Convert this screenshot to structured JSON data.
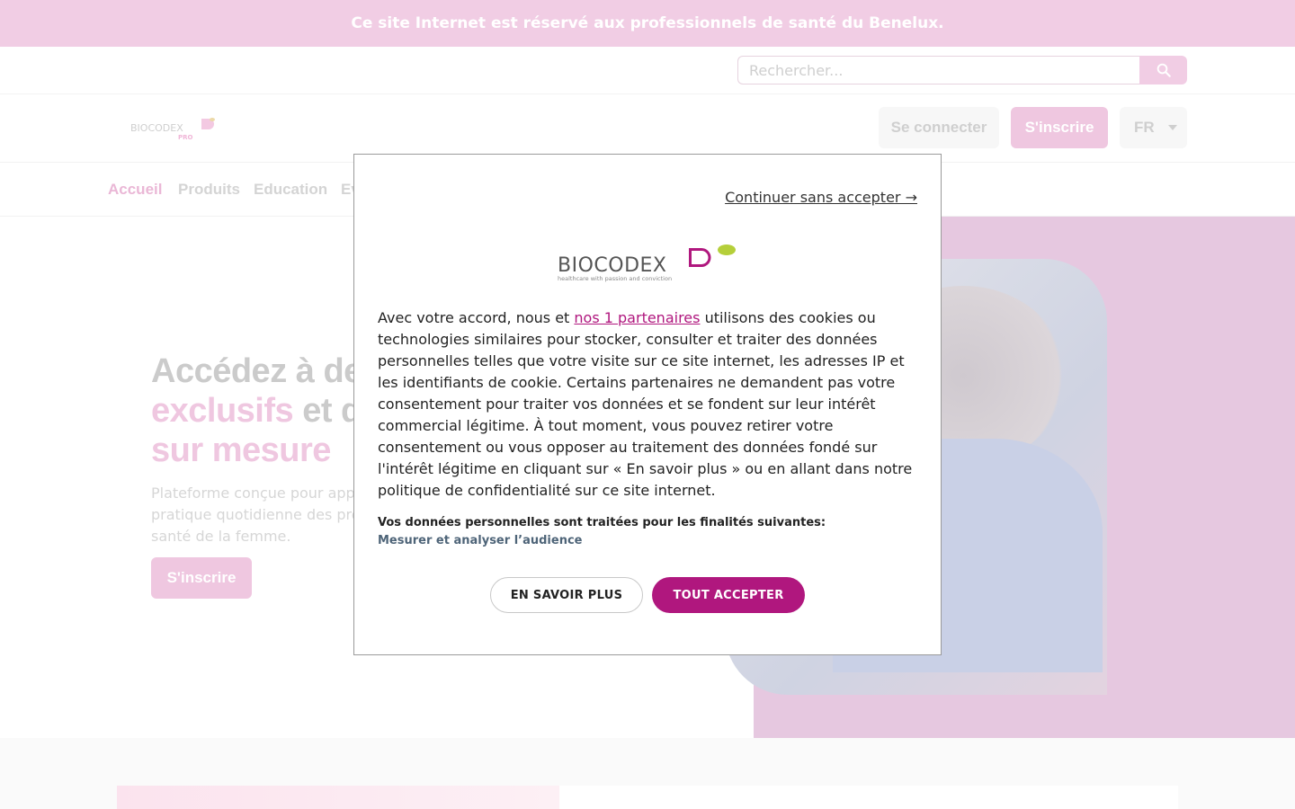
{
  "topbar": {
    "text": "Ce site Internet est réservé aux professionnels de santé du Benelux."
  },
  "search": {
    "placeholder": "Rechercher..."
  },
  "header": {
    "logo_text": "BIOCODEX",
    "logo_sub": "PRO",
    "login_label": "Se connecter",
    "signup_label": "S'inscrire",
    "language": "FR"
  },
  "nav": {
    "items": [
      {
        "label": "Accueil"
      },
      {
        "label": "Produits"
      },
      {
        "label": "Education"
      },
      {
        "label": "Ev"
      }
    ]
  },
  "hero": {
    "title_part1": "Accédez à de",
    "title_part2": "exclusifs",
    "title_part3": " et de",
    "title_part4": "sur mesure",
    "subtitle_line1": "Plateforme conçue pour appor",
    "subtitle_line2": "pratique quotidienne des profe",
    "subtitle_line3": "santé de la femme.",
    "button_label": "S'inscrire"
  },
  "consent": {
    "continue_label": "Continuer sans accepter →",
    "logo_text": "BIOCODEX",
    "logo_tagline": "healthcare with passion and conviction",
    "text_before_link": "Avec votre accord, nous et ",
    "link_text": "nos 1 partenaires",
    "text_after_link": " utilisons des cookies ou technologies similaires pour stocker, consulter et traiter des données personnelles telles que votre visite sur ce site internet, les adresses IP et les identifiants de cookie. Certains partenaires ne demandent pas votre consentement pour traiter vos données et se fondent sur leur intérêt commercial légitime. À tout moment, vous pouvez retirer votre consentement ou vous opposer au traitement des données fondé sur l'intérêt légitime en cliquant sur « En savoir plus » ou en allant dans notre politique de confidentialité sur ce site internet.",
    "purposes_title": "Vos données personnelles sont traitées pour les finalités suivantes:",
    "purpose_1": "Mesurer et analyser l’audience",
    "learn_more_label": "EN SAVOIR PLUS",
    "accept_label": "TOUT ACCEPTER"
  },
  "colors": {
    "brand": "#b0177e",
    "brand_light": "#f1cde4",
    "accent_green": "#b5cf3a"
  }
}
